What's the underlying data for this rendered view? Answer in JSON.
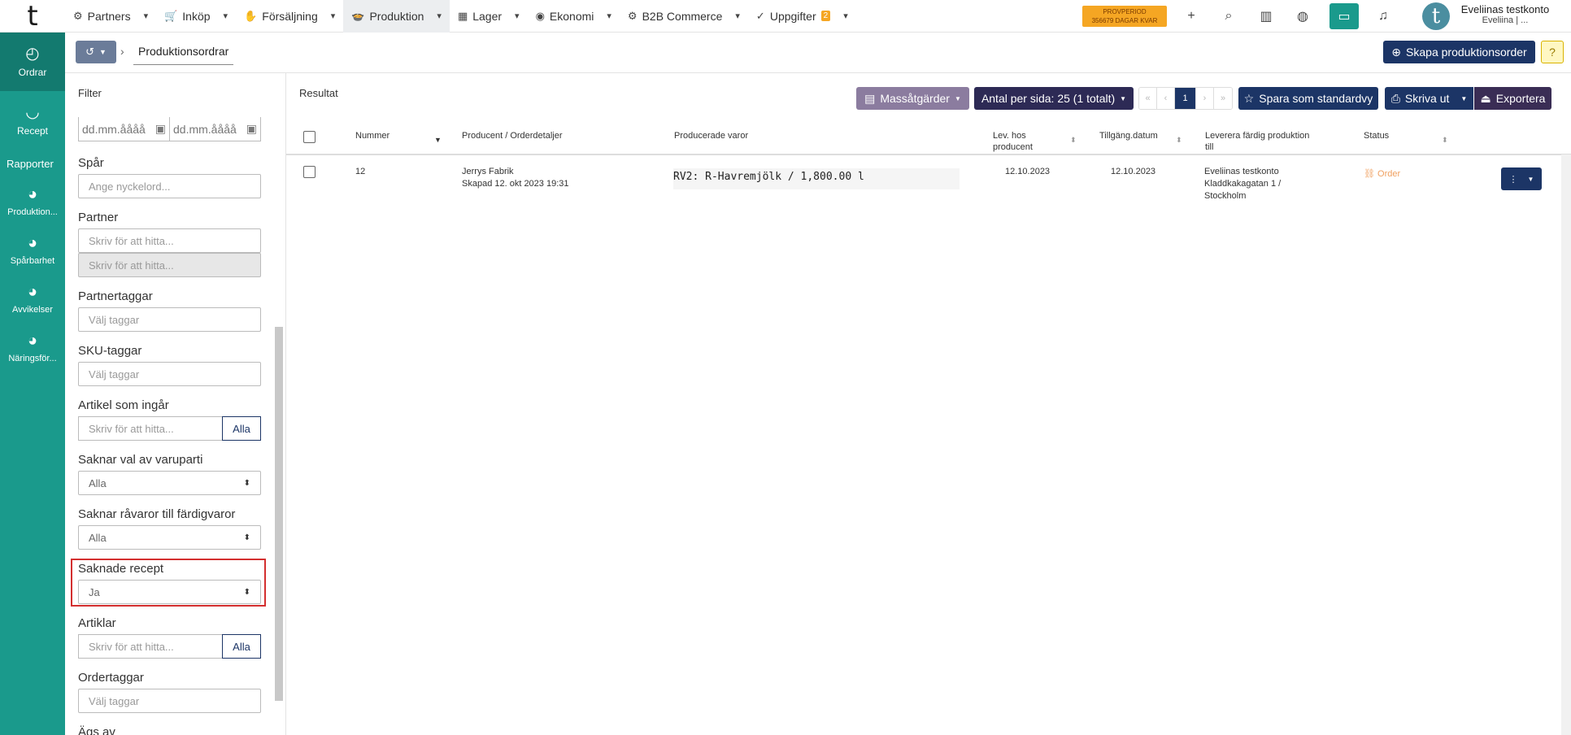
{
  "nav": {
    "items": [
      {
        "icon": "⚙",
        "label": "Partners"
      },
      {
        "icon": "🛒",
        "label": "Inköp"
      },
      {
        "icon": "✋",
        "label": "Försäljning"
      },
      {
        "icon": "🍲",
        "label": "Produktion"
      },
      {
        "icon": "▦",
        "label": "Lager"
      },
      {
        "icon": "◉",
        "label": "Ekonomi"
      },
      {
        "icon": "⚙",
        "label": "B2B Commerce"
      },
      {
        "icon": "✓",
        "label": "Uppgifter"
      }
    ],
    "tasks_badge": "2",
    "trial_line1": "PROVPERIOD",
    "trial_line2": "356679 DAGAR KVAR",
    "account_name": "Eveliinas testkonto",
    "account_user": "Eveliina | ..."
  },
  "sidebar": {
    "items": [
      {
        "label": "Ordrar"
      },
      {
        "label": "Recept"
      }
    ],
    "reports_heading": "Rapporter",
    "reports": [
      {
        "label": "Produktion..."
      },
      {
        "label": "Spårbarhet"
      },
      {
        "label": "Avvikelser"
      },
      {
        "label": "Näringsför..."
      }
    ]
  },
  "breadcrumb": {
    "current": "Produktionsordrar",
    "create_label": "Skapa produktionsorder",
    "help_label": "?"
  },
  "filter": {
    "title": "Filter",
    "date_placeholder": "dd.mm.åååå",
    "spar_label": "Spår",
    "spar_placeholder": "Ange nyckelord...",
    "partner_label": "Partner",
    "partner_placeholder": "Skriv för att hitta...",
    "partner_placeholder2": "Skriv för att hitta...",
    "partnertaggar_label": "Partnertaggar",
    "partnertaggar_placeholder": "Välj taggar",
    "sku_label": "SKU-taggar",
    "sku_placeholder": "Välj taggar",
    "artikel_label": "Artikel som ingår",
    "artikel_placeholder": "Skriv för att hitta...",
    "artikel_all": "Alla",
    "varuparti_label": "Saknar val av varuparti",
    "varuparti_value": "Alla",
    "ravaror_label": "Saknar råvaror till färdigvaror",
    "ravaror_value": "Alla",
    "recept_label": "Saknade recept",
    "recept_value": "Ja",
    "artiklar_label": "Artiklar",
    "artiklar_placeholder": "Skriv för att hitta...",
    "artiklar_all": "Alla",
    "ordertaggar_label": "Ordertaggar",
    "ordertaggar_placeholder": "Välj taggar",
    "ags_label": "Ägs av"
  },
  "results": {
    "title": "Resultat",
    "mass_label": "Massåtgärder",
    "per_page_label": "Antal per sida: 25 (1 totalt)",
    "pager": {
      "first": "«",
      "prev": "‹",
      "current": "1",
      "next": "›",
      "last": "»"
    },
    "save_view_label": "Spara som standardvy",
    "print_label": "Skriva ut",
    "export_label": "Exportera",
    "columns": {
      "number": "Nummer",
      "producer": "Producent / Orderdetaljer",
      "produced": "Producerade varor",
      "lev_line1": "Lev. hos",
      "lev_line2": "producent",
      "available": "Tillgäng.datum",
      "deliver_line1": "Leverera färdig produktion",
      "deliver_line2": "till",
      "status": "Status"
    },
    "rows": [
      {
        "number": "12",
        "producer": "Jerrys Fabrik",
        "created": "Skapad 12. okt 2023 19:31",
        "produced": "RV2: R-Havremjölk / 1,800.00 l",
        "lev_date": "12.10.2023",
        "available_date": "12.10.2023",
        "deliver_line1": "Eveliinas testkonto",
        "deliver_line2": "Kladdkakagatan 1 /",
        "deliver_line3": "Stockholm",
        "status": "Order"
      }
    ]
  }
}
